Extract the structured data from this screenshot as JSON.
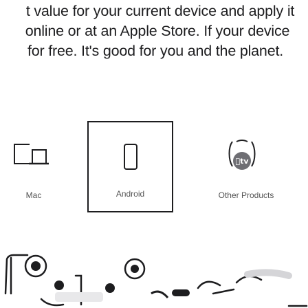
{
  "intro": {
    "line1": "t value for your current device and apply it",
    "line2": "online or at an Apple Store. If your device",
    "line3": "for free. It's good for you and the planet."
  },
  "devices": {
    "mac_label": "Mac",
    "android_label": "Android",
    "other_label": "Other Products",
    "tv_badge": "tv",
    "selected": "Android"
  },
  "icons": {
    "mac": "mac-desktop-laptop-icon",
    "android": "android-phone-outline-icon",
    "other": "apple-tv-remote-badge-icon"
  },
  "colors": {
    "text": "#1d1d1f",
    "label": "#545454",
    "selected_border": "#1d1d1f",
    "icon_stroke": "#1d1d1f",
    "tv_badge": "#6e6e73"
  }
}
